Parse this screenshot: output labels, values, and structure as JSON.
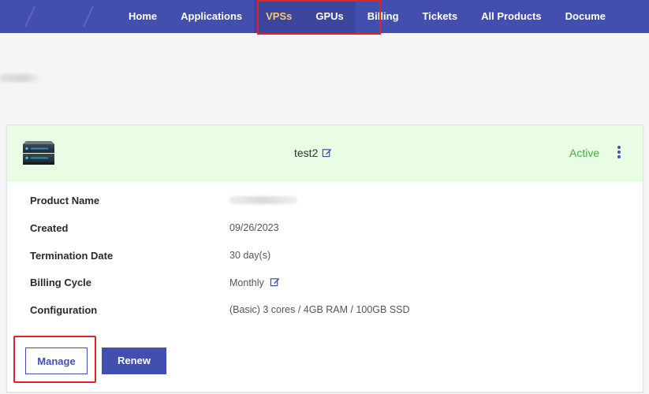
{
  "nav": {
    "items": [
      {
        "label": "Home"
      },
      {
        "label": "Applications"
      },
      {
        "label": "VPSs"
      },
      {
        "label": "GPUs"
      },
      {
        "label": "Billing"
      },
      {
        "label": "Tickets"
      },
      {
        "label": "All Products"
      },
      {
        "label": "Docume"
      }
    ],
    "active_item": "VPSs",
    "accent_color": "#434fae",
    "active_text_color": "#f6c87a"
  },
  "service": {
    "name": "test2",
    "status": "Active",
    "status_color": "#3cb043",
    "header_bg": "#e8fde3",
    "icon": "server-icon"
  },
  "details": [
    {
      "label": "Product Name",
      "value": ""
    },
    {
      "label": "Created",
      "value": "09/26/2023"
    },
    {
      "label": "Termination Date",
      "value": "30 day(s)"
    },
    {
      "label": "Billing Cycle",
      "value": "Monthly"
    },
    {
      "label": "Configuration",
      "value": "(Basic) 3 cores / 4GB RAM / 100GB SSD"
    }
  ],
  "buttons": {
    "manage": "Manage",
    "renew": "Renew"
  },
  "highlight_color": "#e32323"
}
